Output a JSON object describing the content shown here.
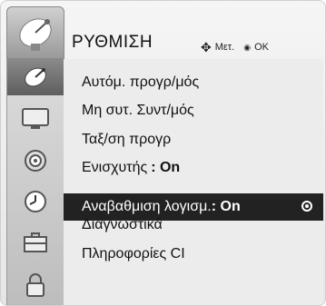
{
  "header": {
    "title": "ΡΥΘΜΙΣΗ",
    "hint_move": "Μετ.",
    "hint_ok": "OK",
    "icon": "satellite-dish-icon"
  },
  "sidebar": {
    "items": [
      {
        "icon": "satellite-dish-icon",
        "active": true
      },
      {
        "icon": "monitor-icon",
        "active": false
      },
      {
        "icon": "speaker-icon",
        "active": false
      },
      {
        "icon": "clock-icon",
        "active": false
      },
      {
        "icon": "toolbox-icon",
        "active": false
      },
      {
        "icon": "lock-icon",
        "active": false
      }
    ]
  },
  "menu": {
    "items": [
      {
        "label": "Αυτόμ. προγρ/μός",
        "value": ""
      },
      {
        "label": "Μη συτ. Συντ/μός",
        "value": ""
      },
      {
        "label": "Ταξ/ση προγρ",
        "value": ""
      },
      {
        "label": "Ενισχυτής",
        "value": ": On"
      },
      {
        "label": "Αναβαθμιση λογισμ.",
        "value": ": On",
        "selected": true
      },
      {
        "label": "Διαγνωστικά",
        "value": ""
      },
      {
        "label": "Πληροφορίες CI",
        "value": ""
      }
    ]
  },
  "colors": {
    "selected_bg": "#222222",
    "panel_bg": "#ececec",
    "sidebar_active": "#6e6e6e"
  }
}
